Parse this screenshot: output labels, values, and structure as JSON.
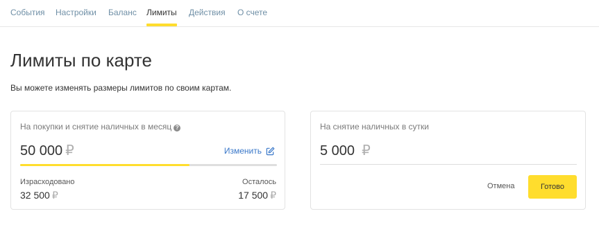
{
  "tabs": [
    {
      "label": "События"
    },
    {
      "label": "Настройки"
    },
    {
      "label": "Баланс"
    },
    {
      "label": "Лимиты",
      "active": true
    },
    {
      "label": "Действия"
    },
    {
      "label": "О счете"
    }
  ],
  "header": {
    "title": "Лимиты по карте",
    "subtitle": "Вы можете изменять размеры лимитов по своим картам."
  },
  "monthly_limit": {
    "label": "На покупки и снятие наличных в месяц",
    "amount": "50 000",
    "currency": "₽",
    "edit_label": "Изменить",
    "progress_fraction": 0.66,
    "spent_label": "Израсходовано",
    "spent_value": "32 500",
    "remaining_label": "Осталось",
    "remaining_value": "17 500"
  },
  "daily_limit": {
    "label": "На снятие наличных в сутки",
    "amount": "5 000",
    "currency": "₽",
    "cancel_label": "Отмена",
    "done_label": "Готово"
  },
  "colors": {
    "accent_yellow": "#ffdd2d",
    "link_blue": "#3a78c9",
    "tab_inactive": "#6f8fa6"
  },
  "icons": {
    "help": "question-circle-icon",
    "edit": "pencil-square-icon"
  }
}
